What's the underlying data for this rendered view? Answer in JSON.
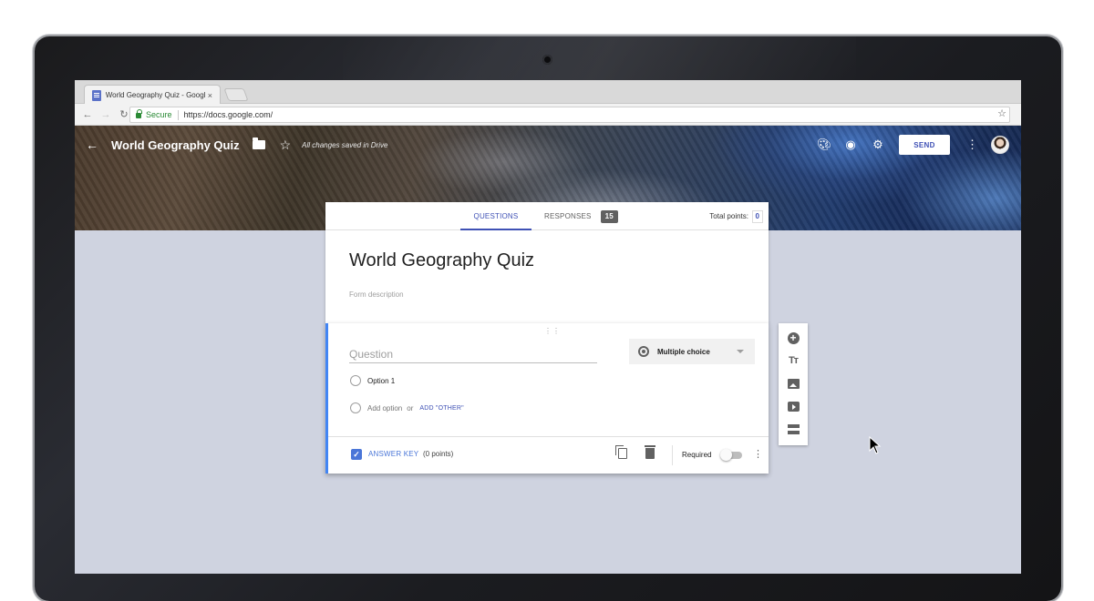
{
  "browser": {
    "tab_title": "World Geography Quiz - Google",
    "tab_close": "×",
    "secure_label": "Secure",
    "url": "https://docs.google.com/"
  },
  "header": {
    "title": "World Geography Quiz",
    "saved_status": "All changes saved in Drive",
    "send_label": "SEND"
  },
  "tabs": {
    "questions": "QUESTIONS",
    "responses": "RESPONSES",
    "responses_count": "15",
    "total_points_label": "Total points:",
    "total_points_value": "0"
  },
  "form": {
    "title": "World Geography Quiz",
    "description_placeholder": "Form description"
  },
  "question": {
    "drag_handle": "⋮⋮",
    "placeholder": "Question",
    "type": "Multiple choice",
    "option1": "Option 1",
    "add_option": "Add option",
    "or": "or",
    "add_other": "ADD \"OTHER\"",
    "answer_key": "ANSWER KEY",
    "points": "(0 points)",
    "required_label": "Required",
    "required": false
  },
  "sidebar": {
    "tt_label": "Tт"
  },
  "colors": {
    "accent": "#3f51b5",
    "question_border": "#4285f4",
    "background": "#cfd3e0"
  },
  "icons": [
    "back-icon",
    "folder-icon",
    "star-icon",
    "palette-icon",
    "preview-eye-icon",
    "settings-gear-icon",
    "more-vert-icon",
    "add-question-icon",
    "add-title-icon",
    "add-image-icon",
    "add-video-icon",
    "add-section-icon",
    "duplicate-icon",
    "delete-icon"
  ]
}
